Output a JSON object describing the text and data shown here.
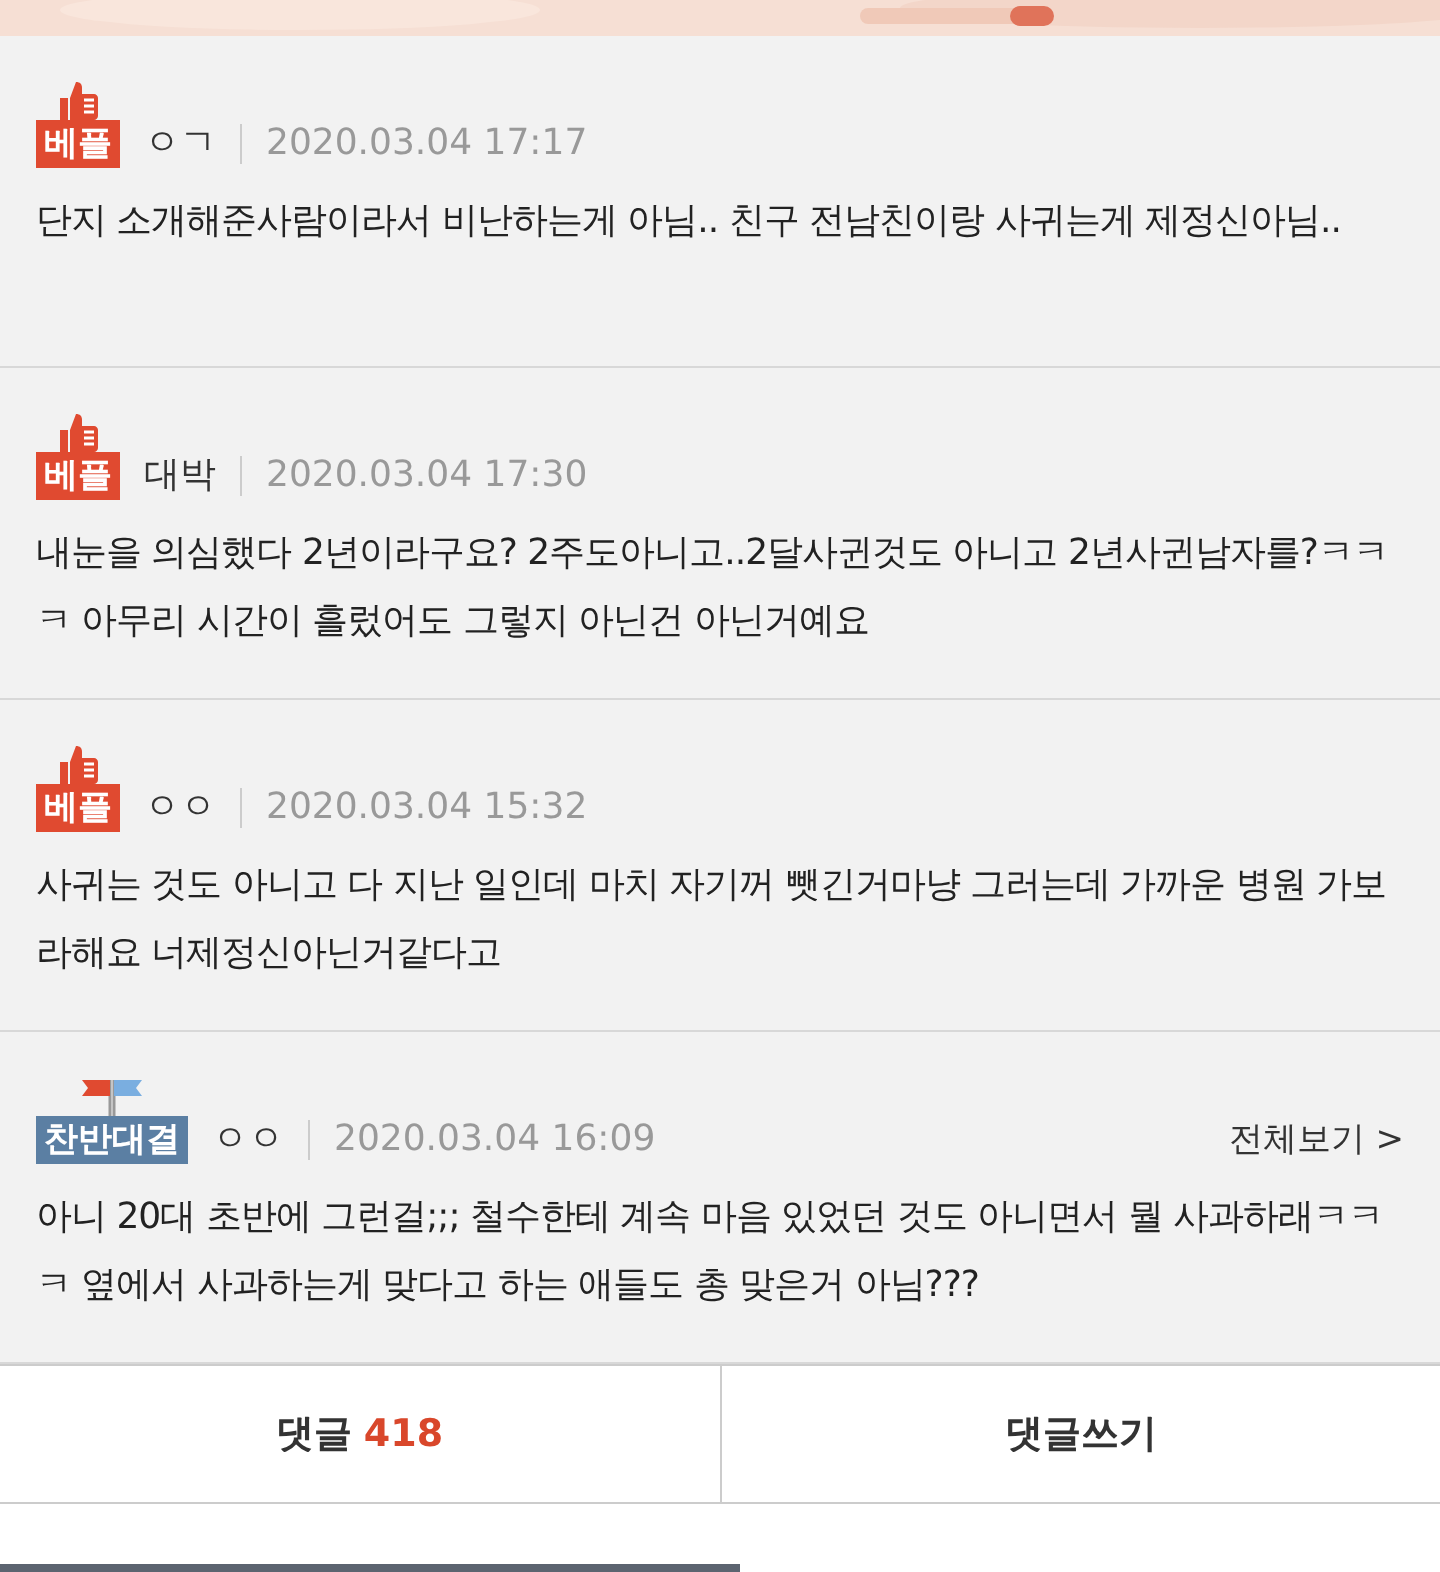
{
  "comments": [
    {
      "badge": {
        "kind": "best",
        "label": "베플"
      },
      "author": "ㅇㄱ",
      "date": "2020.03.04 17:17",
      "text": "단지 소개해준사람이라서 비난하는게 아님.. 친구 전남친이랑 사귀는게 제정신아님.."
    },
    {
      "badge": {
        "kind": "best",
        "label": "베플"
      },
      "author": "대박",
      "date": "2020.03.04 17:30",
      "text": "내눈을 의심했다 2년이라구요? 2주도아니고..2달사귄것도 아니고 2년사귄남자를?ㅋㅋㅋ 아무리 시간이 흘렀어도 그렇지 아닌건 아닌거예요"
    },
    {
      "badge": {
        "kind": "best",
        "label": "베플"
      },
      "author": "ㅇㅇ",
      "date": "2020.03.04 15:32",
      "text": "사귀는 것도 아니고 다 지난 일인데 마치 자기꺼 뺏긴거마냥 그러는데 가까운 병원 가보라해요 너제정신아닌거같다고"
    },
    {
      "badge": {
        "kind": "versus",
        "label": "찬반대결"
      },
      "author": "ㅇㅇ",
      "date": "2020.03.04 16:09",
      "more": "전체보기 >",
      "text": "아니 20대 초반에 그런걸;;; 철수한테 계속 마음 있었던 것도 아니면서 뭘 사과하래ㅋㅋㅋ 옆에서 사과하는게 맞다고 하는 애들도 총 맞은거 아님???"
    }
  ],
  "footer": {
    "comments_label": "댓글",
    "comments_count": "418",
    "write_label": "댓글쓰기"
  }
}
